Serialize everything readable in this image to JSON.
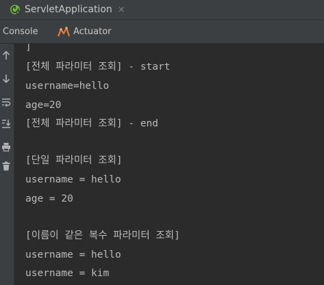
{
  "run_tab": {
    "title": "ServletApplication",
    "close_glyph": "×",
    "icon": "spring-boot-icon"
  },
  "tool_tabs": {
    "console": "Console",
    "actuator": "Actuator",
    "actuator_icon": "actuator-icon"
  },
  "gutter_icons": [
    "arrow-up-icon",
    "arrow-down-icon",
    "soft-wrap-icon",
    "scroll-to-end-icon",
    "print-icon",
    "trash-icon"
  ],
  "console": {
    "lines": [
      "]",
      "[전체 파라미터 조회] - start",
      "username=hello",
      "age=20",
      "[전체 파라미터 조회] - end",
      "",
      "[단일 파라미터 조회]",
      "username = hello",
      "age = 20",
      "",
      "[이름이 같은 복수 파라미터 조회]",
      "username = hello",
      "username = kim"
    ]
  },
  "colors": {
    "background": "#2b2b2b",
    "panel": "#3c3f41",
    "text": "#bbbbbb",
    "spring_green": "#6db33f",
    "actuator_orange": "#e07b39"
  }
}
